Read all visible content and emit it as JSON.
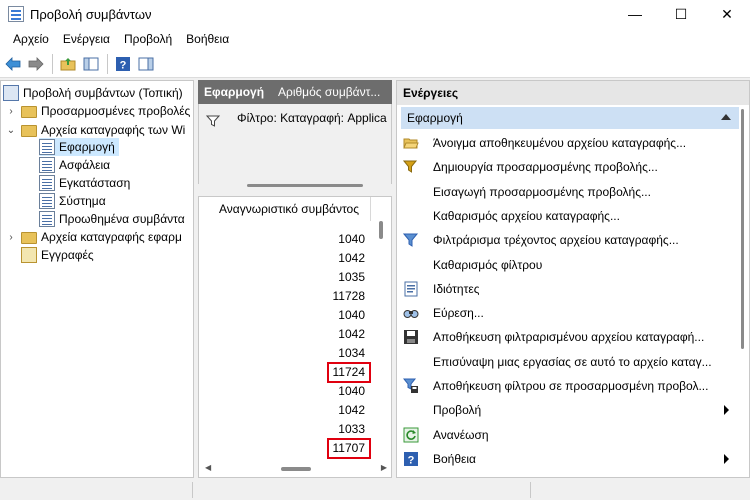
{
  "window": {
    "title": "Προβολή συμβάντων",
    "minimize": "—",
    "maximize": "☐",
    "close": "✕"
  },
  "menu": [
    "Αρχείο",
    "Ενέργεια",
    "Προβολή",
    "Βοήθεια"
  ],
  "tree": {
    "root": "Προβολή συμβάντων (Τοπική)",
    "custom_views": "Προσαρμοσμένες προβολές",
    "windows_logs": "Αρχεία καταγραφής των Wi",
    "app": "Εφαρμογή",
    "security": "Ασφάλεια",
    "setup": "Εγκατάσταση",
    "system": "Σύστημα",
    "forwarded": "Προωθημένα συμβάντα",
    "app_services": "Αρχεία καταγραφής εφαρμ",
    "subscriptions": "Εγγραφές"
  },
  "middle": {
    "title": "Εφαρμογή",
    "count_label": "Αριθμός συμβάντ...",
    "filter": "Φίλτρο: Καταγραφή: Applica",
    "column": "Αναγνωριστικό συμβάντος",
    "ids": [
      "1040",
      "1042",
      "1035",
      "11728",
      "1040",
      "1042",
      "1034",
      "11724",
      "1040",
      "1042",
      "1033",
      "11707"
    ],
    "highlighted": [
      "11724",
      "11707"
    ]
  },
  "actions": {
    "header": "Ενέργειες",
    "section": "Εφαρμογή",
    "items": [
      {
        "label": "Άνοιγμα αποθηκευμένου αρχείου καταγραφής...",
        "icon": "folder-open-icon"
      },
      {
        "label": "Δημιουργία προσαρμοσμένης προβολής...",
        "icon": "filter-star-icon"
      },
      {
        "label": "Εισαγωγή προσαρμοσμένης προβολής...",
        "icon": ""
      },
      {
        "label": "Καθαρισμός αρχείου καταγραφής...",
        "icon": ""
      },
      {
        "label": "Φιλτράρισμα τρέχοντος αρχείου καταγραφής...",
        "icon": "filter-icon"
      },
      {
        "label": "Καθαρισμός φίλτρου",
        "icon": ""
      },
      {
        "label": "Ιδιότητες",
        "icon": "properties-icon"
      },
      {
        "label": "Εύρεση...",
        "icon": "find-icon"
      },
      {
        "label": "Αποθήκευση φιλτραρισμένου αρχείου καταγραφή...",
        "icon": "save-icon"
      },
      {
        "label": "Επισύναψη μιας εργασίας σε αυτό το αρχείο καταγ...",
        "icon": ""
      },
      {
        "label": "Αποθήκευση φίλτρου σε προσαρμοσμένη προβολ...",
        "icon": "filter-save-icon"
      },
      {
        "label": "Προβολή",
        "icon": "",
        "submenu": true
      },
      {
        "label": "Ανανέωση",
        "icon": "refresh-icon"
      },
      {
        "label": "Βοήθεια",
        "icon": "help-icon",
        "submenu": true
      }
    ]
  },
  "colors": {
    "highlight": "#e0000f",
    "selection": "#cce8ff",
    "section": "#cde0f4",
    "header_dark": "#6d6d6d"
  }
}
